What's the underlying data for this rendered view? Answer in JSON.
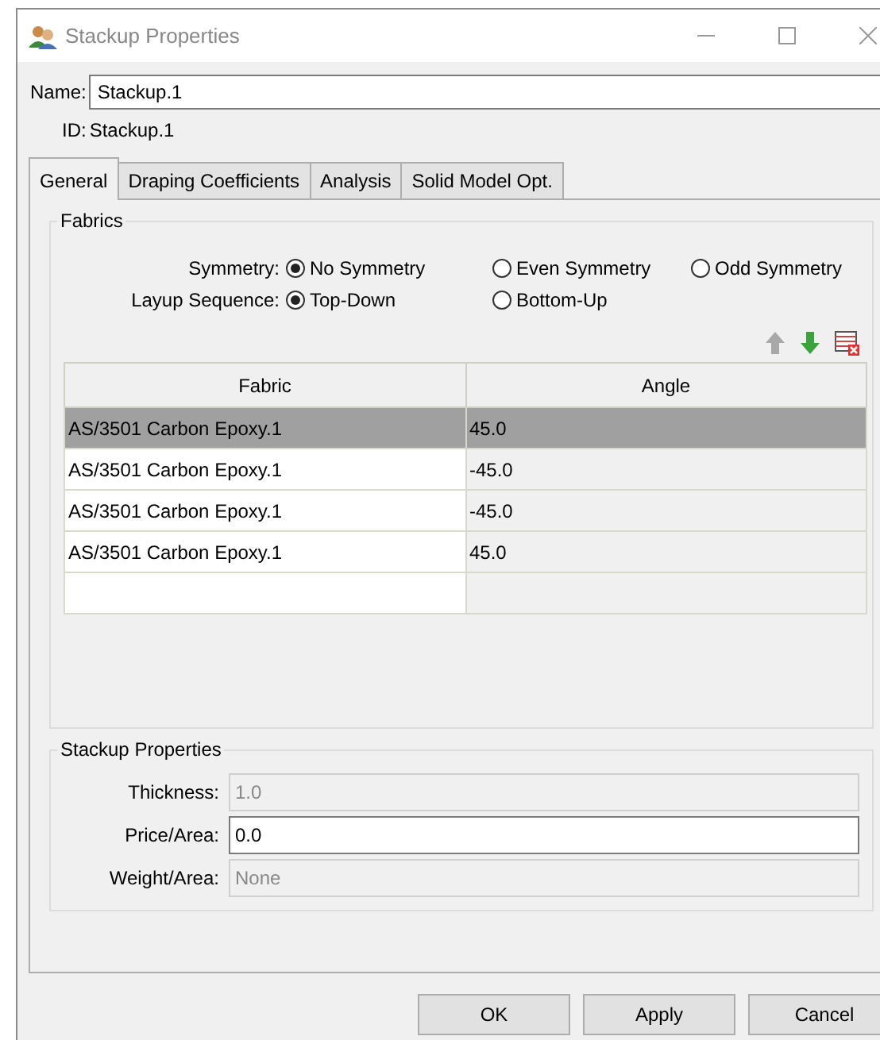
{
  "window": {
    "title": "Stackup Properties"
  },
  "name_field": {
    "label": "Name:",
    "value": "Stackup.1"
  },
  "id_field": {
    "label": "ID:",
    "value": "Stackup.1"
  },
  "tabs": [
    {
      "label": "General",
      "selected": true
    },
    {
      "label": "Draping Coefficients",
      "selected": false
    },
    {
      "label": "Analysis",
      "selected": false
    },
    {
      "label": "Solid Model Opt.",
      "selected": false
    }
  ],
  "fabrics": {
    "title": "Fabrics",
    "radio_groups": [
      {
        "label": "Symmetry:",
        "options": [
          {
            "label": "No Symmetry",
            "selected": true
          },
          {
            "label": "Even Symmetry",
            "selected": false
          },
          {
            "label": "Odd Symmetry",
            "selected": false
          }
        ]
      },
      {
        "label": "Layup Sequence:",
        "options": [
          {
            "label": "Top-Down",
            "selected": true
          },
          {
            "label": "Bottom-Up",
            "selected": false
          }
        ]
      }
    ],
    "toolbar": [
      {
        "kind": "up",
        "disabled": true
      },
      {
        "kind": "down",
        "disabled": false
      },
      {
        "kind": "delete",
        "disabled": false
      }
    ],
    "table": {
      "columns": [
        "Fabric",
        "Angle"
      ],
      "rows": [
        {
          "cells": [
            "AS/3501 Carbon Epoxy.1",
            "45.0"
          ],
          "selected": true
        },
        {
          "cells": [
            "AS/3501 Carbon Epoxy.1",
            "-45.0"
          ],
          "selected": false
        },
        {
          "cells": [
            "AS/3501 Carbon Epoxy.1",
            "-45.0"
          ],
          "selected": false
        },
        {
          "cells": [
            "AS/3501 Carbon Epoxy.1",
            "45.0"
          ],
          "selected": false
        },
        {
          "cells": [
            "",
            ""
          ],
          "selected": false
        }
      ]
    }
  },
  "stackup_properties": {
    "title": "Stackup Properties",
    "fields": [
      {
        "label": "Thickness:",
        "value": "1.0",
        "disabled": true
      },
      {
        "label": "Price/Area:",
        "value": "0.0",
        "disabled": false
      },
      {
        "label": "Weight/Area:",
        "value": "None",
        "disabled": true
      }
    ]
  },
  "buttons": [
    "OK",
    "Apply",
    "Cancel"
  ]
}
